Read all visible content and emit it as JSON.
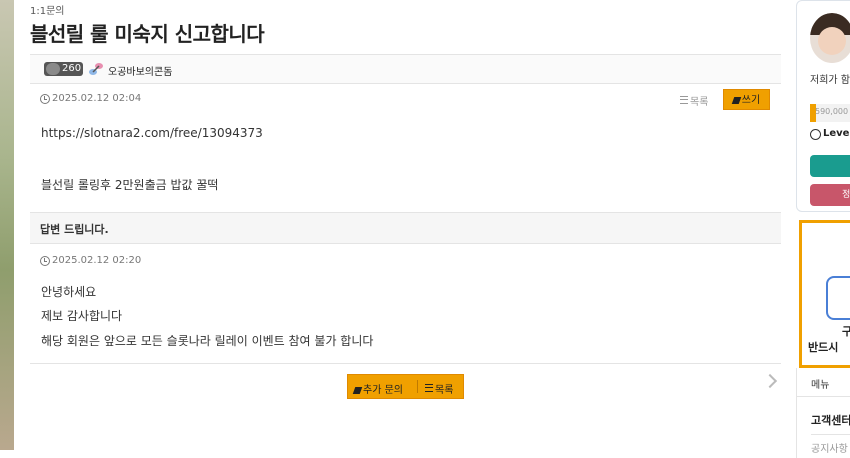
{
  "breadcrumb": "1:1문의",
  "post": {
    "title": "블선릴 룰 미숙지 신고합니다",
    "author_level": "260",
    "author_name": "오공바보의콘돔",
    "date": "2025.02.12 02:04",
    "list_label": "목록",
    "write_label": "쓰기",
    "body_url": "https://slotnara2.com/free/13094373",
    "body_line": "블선릴 롤링후 2만원출금 밥값 꿀떡"
  },
  "answer": {
    "title": "답변 드립니다.",
    "date": "2025.02.12 02:20",
    "lines": [
      "안녕하세요",
      "제보 감사합니다",
      "해당 회원은 앞으로 모든 슬롯나라 릴레이 이벤트 참여 불가 합니다"
    ]
  },
  "bottom": {
    "more_question_label": "추가 문의",
    "list_label": "목록"
  },
  "sidebar": {
    "greeting": "저희가 함",
    "points": "590,000",
    "level_label": "Level",
    "pink_button_label": "정",
    "notice_line1": "구",
    "notice_line2": "반드시 ",
    "menu_title": "메뉴",
    "menu_item": "고객센터",
    "menu_item2": "공지사항"
  },
  "colors": {
    "accent": "#f0a000",
    "teal": "#1a9c8f",
    "pink": "#c8566a"
  }
}
